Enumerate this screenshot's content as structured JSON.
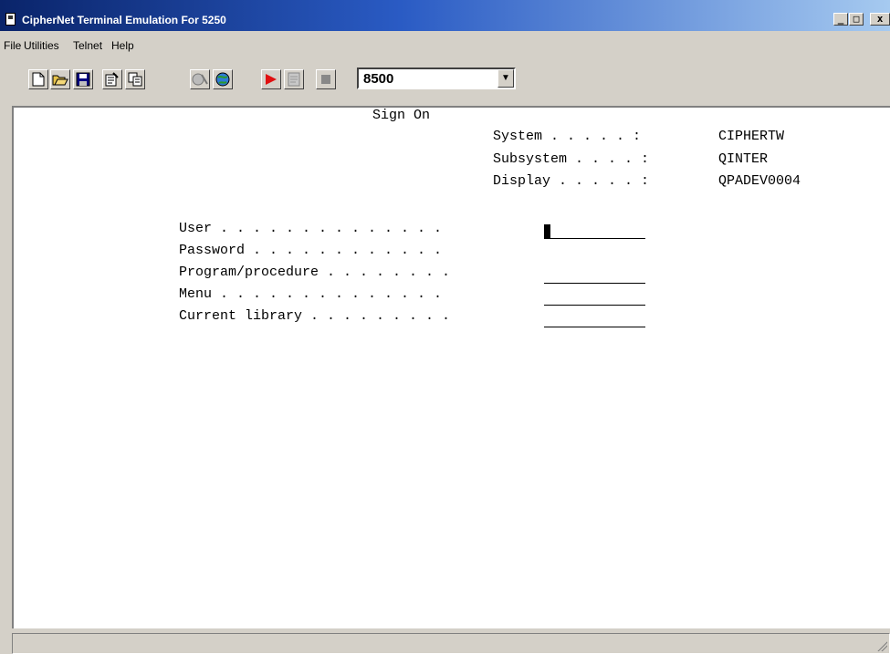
{
  "window": {
    "title": "CipherNet Terminal Emulation For 5250"
  },
  "menu": {
    "items": [
      "File",
      "Utilities",
      "Telnet",
      "Help"
    ]
  },
  "toolbar": {
    "session_value": "8500"
  },
  "terminal": {
    "heading": "Sign On",
    "system_label": "System . . . . . :",
    "system_value": "CIPHERTW",
    "subsystem_label": "Subsystem . . . . :",
    "subsystem_value": "QINTER",
    "display_label": "Display . . . . . :",
    "display_value": "QPADEV0004",
    "user_label": "User . . . . . . . . . . . . . .",
    "password_label": "Password . . . . . . . . . . . .",
    "program_label": "Program/procedure . . . . . . . .",
    "menu_label": "Menu . . . . . . . . . . . . . .",
    "library_label": "Current library . . . . . . . . .",
    "user_value": "",
    "program_value": "",
    "menu_value": "",
    "library_value": ""
  }
}
